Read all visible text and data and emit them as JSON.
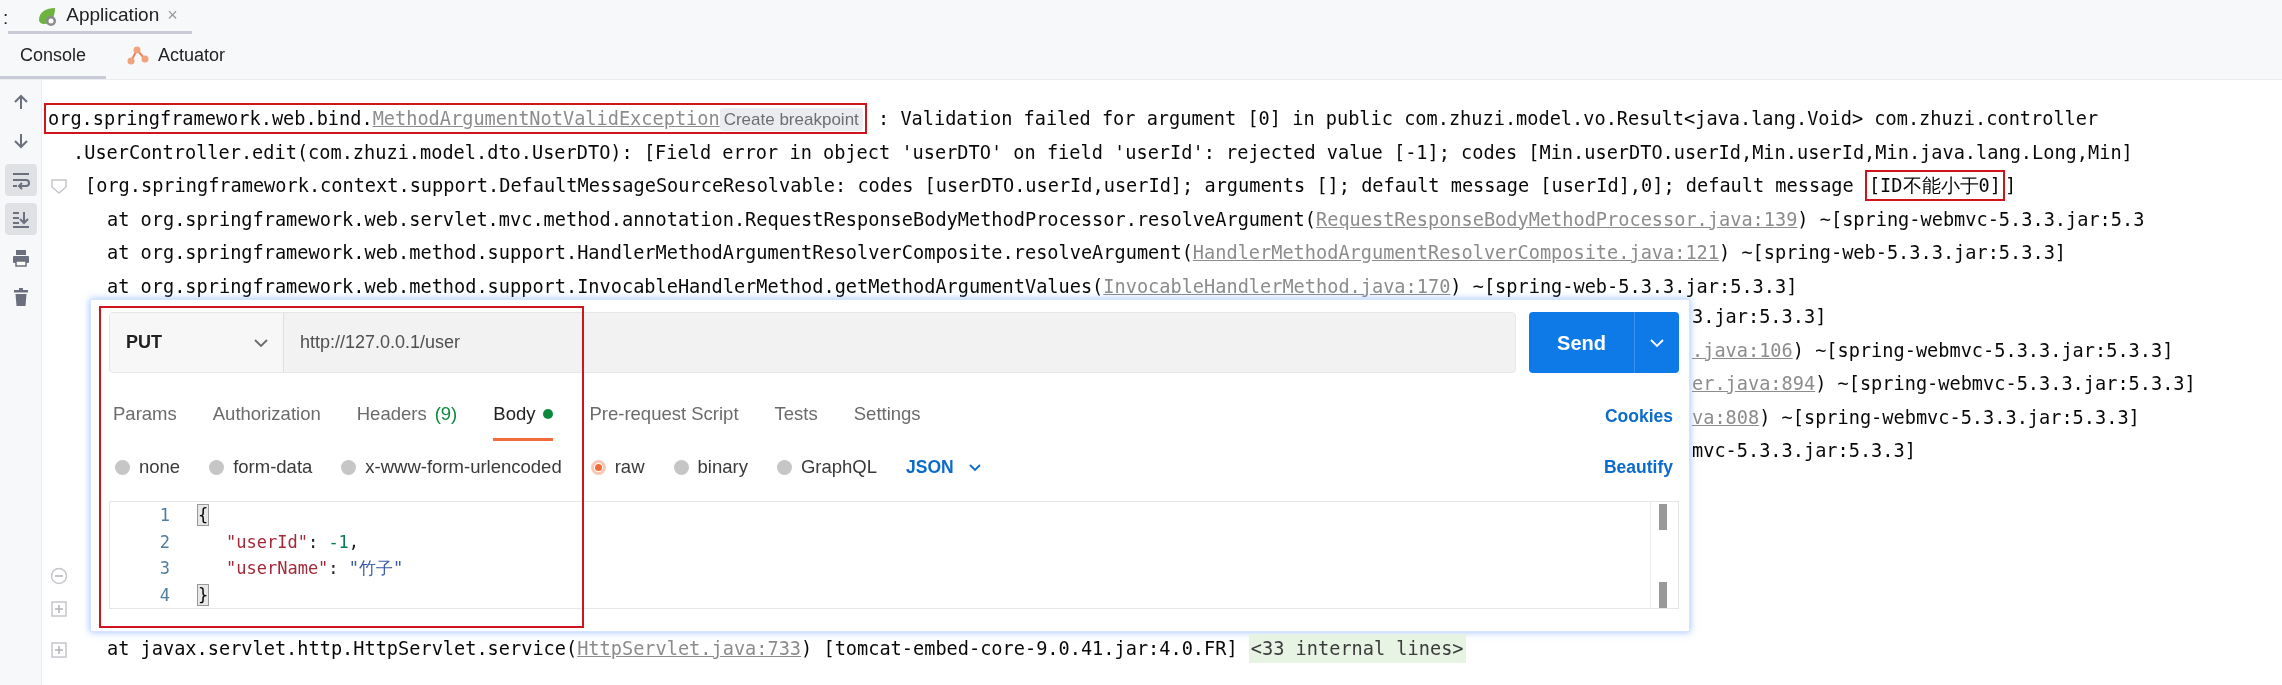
{
  "run_tabs_prefix": ":",
  "run_tab": {
    "label": "Application",
    "close_glyph": "×",
    "selected": true
  },
  "tool_tabs": [
    {
      "label": "Console",
      "selected": true
    },
    {
      "label": "Actuator",
      "selected": false
    }
  ],
  "toolbar": [
    {
      "kind": "up",
      "on": false
    },
    {
      "kind": "down",
      "on": false
    },
    {
      "kind": "wrap",
      "on": true
    },
    {
      "kind": "scroll-end",
      "on": true
    },
    {
      "kind": "print",
      "on": false
    },
    {
      "kind": "delete",
      "on": false
    }
  ],
  "console": {
    "lines": [
      {
        "kind": "head",
        "segments": [
          {
            "kind": "text",
            "text": "org.springframework.web.bind.",
            "boxed": true
          },
          {
            "kind": "link",
            "text": "MethodArgumentNotValidException",
            "boxed": true
          },
          {
            "kind": "hint",
            "text": "Create breakpoint",
            "boxed": true
          },
          {
            "kind": "text",
            "text": " : Validation failed for argument [0] in public com.zhuzi.model.vo.Result<java.lang.Void> com.zhuzi.controller",
            "boxed": false
          }
        ]
      },
      {
        "kind": "wrap",
        "segments": [
          {
            "kind": "text",
            "text": ".UserController.edit(com.zhuzi.model.dto.UserDTO): [Field error in object 'userDTO' on field 'userId': rejected value [-1]; codes [Min.userDTO.userId,Min.userId,Min.java.lang.Long,Min]",
            "boxed": false
          }
        ]
      },
      {
        "kind": "cont",
        "fold": {
          "kind": "marker"
        },
        "segments": [
          {
            "kind": "text",
            "text": "[org.springframework.context.support.DefaultMessageSourceResolvable: codes [userDTO.userId,userId]; arguments []; default message [userId],0]; default message ",
            "boxed": false
          },
          {
            "kind": "text",
            "text": "[ID不能小于0]",
            "boxed": true
          },
          {
            "kind": "text",
            "text": "]",
            "boxed": false
          }
        ]
      },
      {
        "kind": "frame",
        "segments": [
          {
            "kind": "text",
            "text": "at org.springframework.web.servlet.mvc.method.annotation.RequestResponseBodyMethodProcessor.resolveArgument(",
            "boxed": false
          },
          {
            "kind": "link",
            "text": "RequestResponseBodyMethodProcessor.java:139",
            "boxed": false
          },
          {
            "kind": "text",
            "text": ") ~[spring-webmvc-5.3.3.jar:5.3",
            "boxed": false
          }
        ]
      },
      {
        "kind": "frame",
        "segments": [
          {
            "kind": "text",
            "text": "at org.springframework.web.method.support.HandlerMethodArgumentResolverComposite.resolveArgument(",
            "boxed": false
          },
          {
            "kind": "link",
            "text": "HandlerMethodArgumentResolverComposite.java:121",
            "boxed": false
          },
          {
            "kind": "text",
            "text": ") ~[spring-web-5.3.3.jar:5.3.3]",
            "boxed": false
          }
        ]
      },
      {
        "kind": "frame",
        "segments": [
          {
            "kind": "text",
            "text": "at org.springframework.web.method.support.InvocableHandlerMethod.getMethodArgumentValues(",
            "boxed": false
          },
          {
            "kind": "link",
            "text": "InvocableHandlerMethod.java:170",
            "boxed": false
          },
          {
            "kind": "text",
            "text": ") ~[spring-web-5.3.3.jar:5.3.3]",
            "boxed": false
          }
        ]
      }
    ],
    "fragments": [
      {
        "segments": [
          {
            "kind": "text",
            "text": "3.jar:5.3.3]"
          }
        ]
      },
      {
        "segments": [
          {
            "kind": "link",
            "text": ".java:106"
          },
          {
            "kind": "text",
            "text": ") ~[spring-webmvc-5.3.3.jar:5.3.3]"
          }
        ]
      },
      {
        "segments": [
          {
            "kind": "link",
            "text": "er.java:894"
          },
          {
            "kind": "text",
            "text": ") ~[spring-webmvc-5.3.3.jar:5.3.3]"
          }
        ]
      },
      {
        "segments": [
          {
            "kind": "link",
            "text": "va:808"
          },
          {
            "kind": "text",
            "text": ") ~[spring-webmvc-5.3.3.jar:5.3.3]"
          }
        ]
      },
      {
        "segments": [
          {
            "kind": "text",
            "text": "mvc-5.3.3.jar:5.3.3]"
          }
        ]
      }
    ],
    "side_folds": [
      {
        "kind": "collapse"
      },
      {
        "kind": "expand"
      }
    ],
    "last_line": {
      "kind": "frame",
      "fold": {
        "kind": "expand"
      },
      "segments": [
        {
          "kind": "text",
          "text": "at javax.servlet.http.HttpServlet.service(",
          "boxed": false
        },
        {
          "kind": "link",
          "text": "HttpServlet.java:733",
          "boxed": false
        },
        {
          "kind": "text",
          "text": ") [tomcat-embed-core-9.0.41.jar:4.0.FR] ",
          "boxed": false
        },
        {
          "kind": "folded",
          "text": "<33 internal lines>",
          "boxed": false
        }
      ]
    }
  },
  "request": {
    "boxed": true,
    "method": "PUT",
    "url": "http://127.0.0.1/user",
    "send": "Send",
    "tabs": [
      {
        "label": "Params",
        "dot": false,
        "selected": false
      },
      {
        "label": "Authorization",
        "dot": false,
        "selected": false
      },
      {
        "label": "Headers",
        "count": "(9)",
        "dot": false,
        "selected": false
      },
      {
        "label": "Body",
        "dot": true,
        "selected": true
      },
      {
        "label": "Pre-request Script",
        "dot": false,
        "selected": false
      },
      {
        "label": "Tests",
        "dot": false,
        "selected": false
      },
      {
        "label": "Settings",
        "dot": false,
        "selected": false
      }
    ],
    "cookies": "Cookies",
    "body_types": [
      {
        "label": "none",
        "selected": false
      },
      {
        "label": "form-data",
        "selected": false
      },
      {
        "label": "x-www-form-urlencoded",
        "selected": false
      },
      {
        "label": "raw",
        "selected": true
      },
      {
        "label": "binary",
        "selected": false
      },
      {
        "label": "GraphQL",
        "selected": false
      }
    ],
    "format": "JSON",
    "beautify": "Beautify",
    "editor_lines": [
      {
        "number": "1",
        "indent": false,
        "tokens": [
          {
            "kind": "brace",
            "text": "{"
          }
        ]
      },
      {
        "number": "2",
        "indent": true,
        "tokens": [
          {
            "kind": "key",
            "text": "\"userId\""
          },
          {
            "kind": "punct",
            "text": ": "
          },
          {
            "kind": "number",
            "text": "-1"
          },
          {
            "kind": "punct",
            "text": ","
          }
        ]
      },
      {
        "number": "3",
        "indent": true,
        "tokens": [
          {
            "kind": "key",
            "text": "\"userName\""
          },
          {
            "kind": "punct",
            "text": ": "
          },
          {
            "kind": "string",
            "text": "\"竹子\""
          }
        ]
      },
      {
        "number": "4",
        "indent": false,
        "tokens": [
          {
            "kind": "brace",
            "text": "}"
          }
        ]
      }
    ]
  }
}
